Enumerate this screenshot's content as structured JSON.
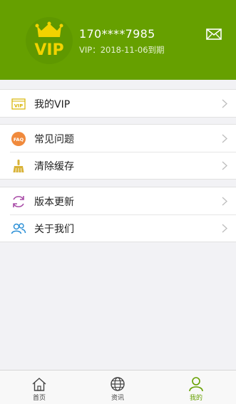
{
  "profile": {
    "badge_text": "VIP",
    "phone": "170****7985",
    "vip_expire": "VIP：2018-11-06到期"
  },
  "menu_groups": [
    {
      "items": [
        {
          "label": "我的VIP",
          "icon": "vip-icon"
        }
      ]
    },
    {
      "items": [
        {
          "label": "常见问题",
          "icon": "faq-icon"
        },
        {
          "label": "清除缓存",
          "icon": "broom-icon"
        }
      ]
    },
    {
      "items": [
        {
          "label": "版本更新",
          "icon": "refresh-icon"
        },
        {
          "label": "关于我们",
          "icon": "people-icon"
        }
      ]
    }
  ],
  "faq_icon_text": "FAQ",
  "vip_icon_text": "VIP",
  "tabs": [
    {
      "label": "首页",
      "icon": "home-icon"
    },
    {
      "label": "资讯",
      "icon": "globe-icon"
    },
    {
      "label": "我的",
      "icon": "user-icon",
      "active": true
    }
  ],
  "colors": {
    "brand_green": "#66a000",
    "badge_yellow": "#f2d300",
    "faq_orange": "#f08a3c",
    "refresh_purple": "#a94da8",
    "people_blue": "#2a8fd6"
  }
}
